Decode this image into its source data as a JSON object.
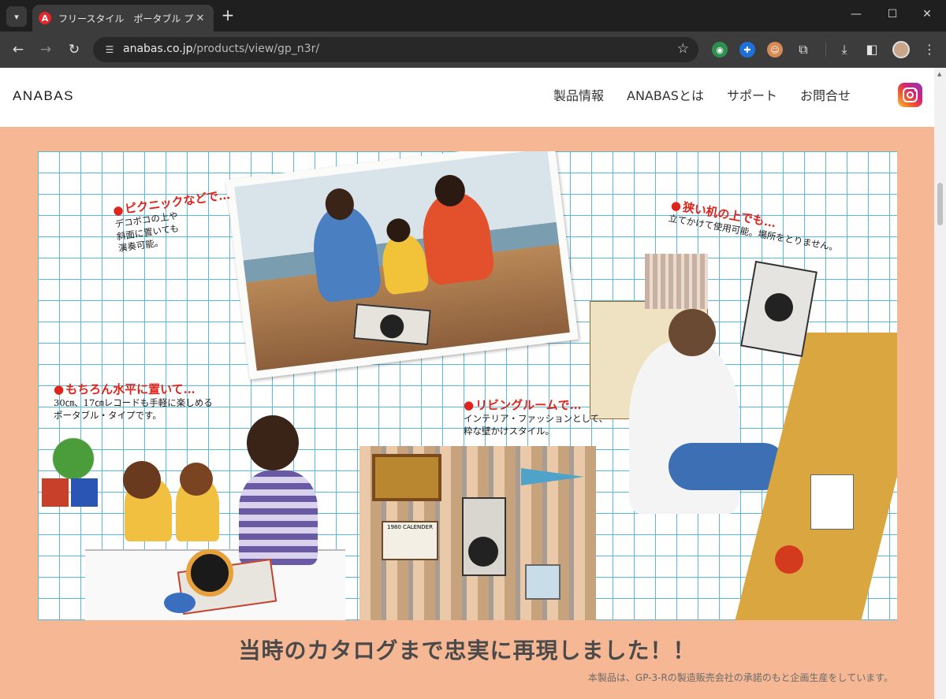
{
  "browser": {
    "tab_title": "フリースタイル　ポータブル プレーヤー…",
    "favicon_letter": "A",
    "url_host": "anabas.co.jp",
    "url_path": "/products/view/gp_n3r/",
    "new_tab_label": "+"
  },
  "site": {
    "logo": "ANABAS",
    "nav": [
      "製品情報",
      "ANABASとは",
      "サポート",
      "お問合せ"
    ]
  },
  "catalog": {
    "captions": [
      {
        "heading": "ピクニックなどで…",
        "body": "デコボコの上や\n斜面に置いても\n演奏可能。"
      },
      {
        "heading": "狭い机の上でも…",
        "body": "立てかけて使用可能。場所をとりません。"
      },
      {
        "heading": "もちろん水平に置いて…",
        "body": "30㎝、17㎝レコードも手軽に楽しめる\nポータブル・タイプです。"
      },
      {
        "heading": "リビングルームで…",
        "body": "インテリア・ファッションとして、\n粋な壁かけスタイル。"
      }
    ],
    "calendar_label": "1980 CALENDER"
  },
  "headline": "当時のカタログまで忠実に再現しました！！",
  "footnote": "本製品は、GP-3-Rの製造販売会社の承諾のもと企画生産をしています。",
  "colors": {
    "page_background": "#f6b894",
    "caption_red": "#e0241c",
    "grid_blue": "#5ab8d8",
    "headline_gray": "#4a4a4a"
  }
}
